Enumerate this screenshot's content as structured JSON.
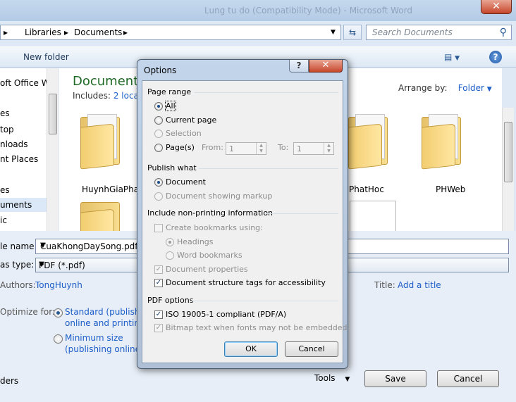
{
  "window": {
    "title": "Lung tu do (Compatibility Mode) - Microsoft Word",
    "close_glyph": "✕"
  },
  "address": {
    "crumbs": [
      "Libraries",
      "Documents"
    ],
    "search_placeholder": "Search Documents"
  },
  "toolbar": {
    "new_folder": "New folder",
    "help": "?"
  },
  "nav": {
    "items": [
      "oft Office W",
      "es",
      "top",
      "nloads",
      "nt Places",
      "es",
      "uments",
      "ic"
    ]
  },
  "content": {
    "library_title": "Documents",
    "includes_label": "Includes:",
    "includes_link": "2 locat",
    "arrange_label": "Arrange by:",
    "arrange_value": "Folder",
    "folders": [
      "HuynhGiaPha",
      "PhatHoc",
      "PHWeb"
    ]
  },
  "form": {
    "file_name_label": "le name:",
    "file_name_value": "CuaKhongDaySong.pdf",
    "save_type_label": "as type:",
    "save_type_value": "PDF (*.pdf)",
    "authors_label": "Authors:",
    "authors_value": "TongHuynh",
    "title_label": "Title:",
    "title_value": "Add a title",
    "optimize_label": "Optimize for:",
    "standard_line1": "Standard (publishing",
    "standard_line2": "online and printing",
    "minimum_line1": "Minimum size",
    "minimum_line2": "(publishing online)",
    "hide_folders": "ders",
    "tools": "Tools",
    "save": "Save",
    "cancel": "Cancel"
  },
  "dialog": {
    "title": "Options",
    "help": "?",
    "close": "✕",
    "page_range": {
      "heading": "Page range",
      "all": "All",
      "current_page": "Current page",
      "selection": "Selection",
      "pages": "Page(s)",
      "from_label": "From:",
      "from_value": "1",
      "to_label": "To:",
      "to_value": "1"
    },
    "publish_what": {
      "heading": "Publish what",
      "document": "Document",
      "document_markup": "Document showing markup"
    },
    "non_printing": {
      "heading": "Include non-printing information",
      "create_bookmarks": "Create bookmarks using:",
      "headings": "Headings",
      "word_bookmarks": "Word bookmarks",
      "doc_properties": "Document properties",
      "doc_structure": "Document structure tags for accessibility"
    },
    "pdf_options": {
      "heading": "PDF options",
      "iso": "ISO 19005-1 compliant (PDF/A)",
      "bitmap": "Bitmap text when fonts may not be embedded"
    },
    "ok": "OK",
    "cancel": "Cancel"
  }
}
